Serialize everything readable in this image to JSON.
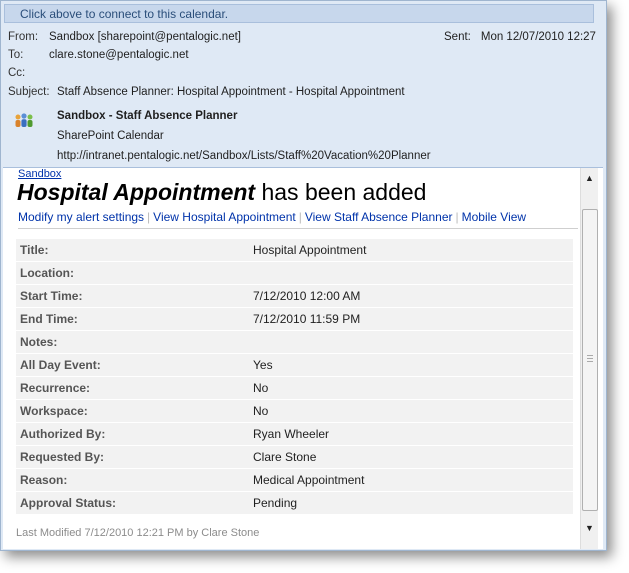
{
  "infobar": {
    "text": "Click above to connect to this calendar."
  },
  "header": {
    "from_label": "From:",
    "from_value": "Sandbox [sharepoint@pentalogic.net]",
    "to_label": "To:",
    "to_value": "clare.stone@pentalogic.net",
    "cc_label": "Cc:",
    "cc_value": "",
    "subject_label": "Subject:",
    "subject_value": "Staff Absence Planner: Hospital Appointment - Hospital Appointment",
    "sent_label": "Sent:",
    "sent_value": "Mon 12/07/2010 12:27"
  },
  "calendar": {
    "title": "Sandbox - Staff Absence Planner",
    "type": "SharePoint Calendar",
    "url": "http://intranet.pentalogic.net/Sandbox/Lists/Staff%20Vacation%20Planner",
    "icon": "people-icon"
  },
  "body": {
    "site_link": "Sandbox",
    "headline_item": "Hospital Appointment",
    "headline_rest": " has been added",
    "links": {
      "modify": "Modify my alert settings",
      "view_item": "View Hospital Appointment",
      "view_list": "View Staff Absence Planner",
      "mobile": "Mobile View",
      "separator": "|"
    },
    "properties": [
      {
        "name": "Title:",
        "value": "Hospital Appointment"
      },
      {
        "name": "Location:",
        "value": ""
      },
      {
        "name": "Start Time:",
        "value": "7/12/2010 12:00 AM"
      },
      {
        "name": "End Time:",
        "value": "7/12/2010 11:59 PM"
      },
      {
        "name": "Notes:",
        "value": ""
      },
      {
        "name": "All Day Event:",
        "value": "Yes"
      },
      {
        "name": "Recurrence:",
        "value": "No"
      },
      {
        "name": "Workspace:",
        "value": "No"
      },
      {
        "name": "Authorized By:",
        "value": "Ryan Wheeler"
      },
      {
        "name": "Requested By:",
        "value": "Clare Stone"
      },
      {
        "name": "Reason:",
        "value": "Medical Appointment"
      },
      {
        "name": "Approval Status:",
        "value": "Pending"
      }
    ],
    "footer": "Last Modified 7/12/2010 12:21 PM by Clare Stone"
  },
  "colors": {
    "link": "#0033aa",
    "infobar_bg": "#c7d7ec",
    "header_bg": "#dfe9f5"
  }
}
